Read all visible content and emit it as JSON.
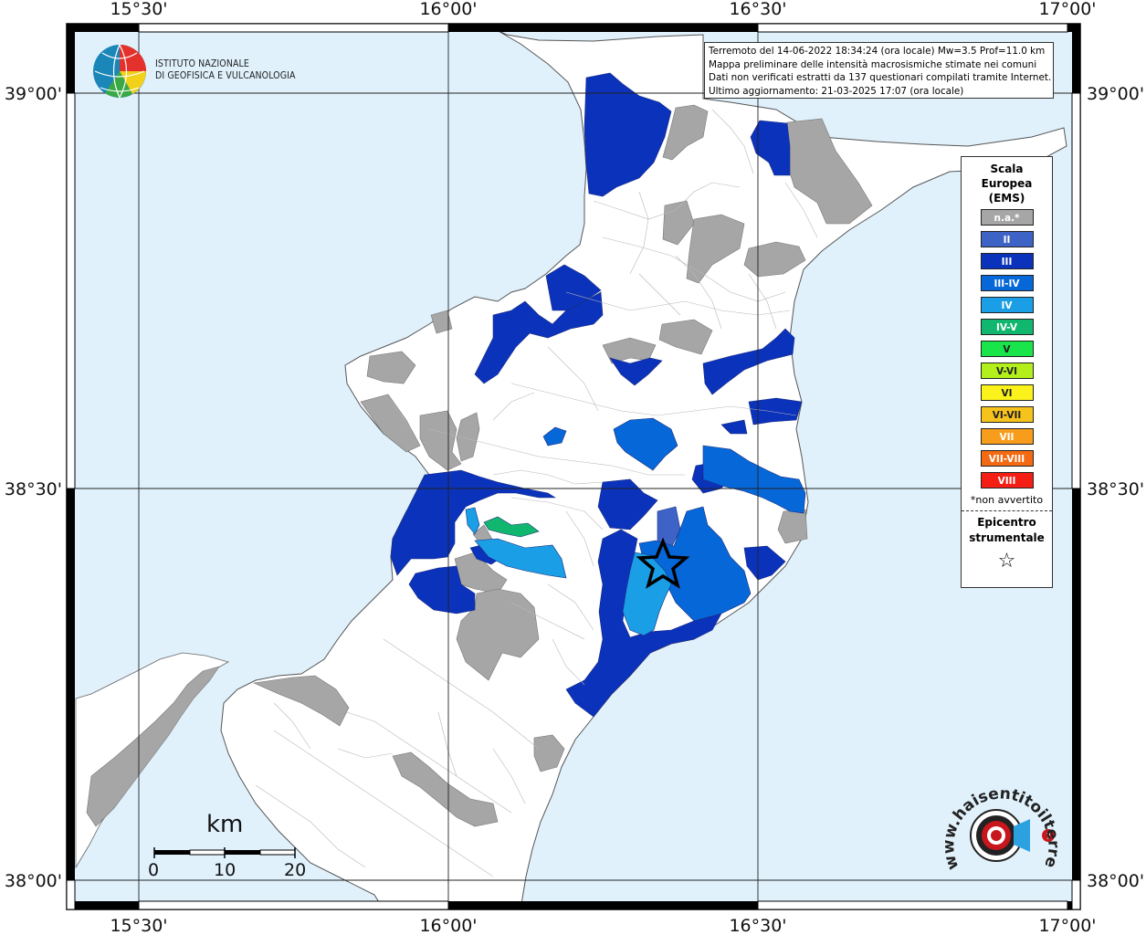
{
  "map": {
    "axes": {
      "top_longitudes": [
        "15°30'",
        "16°00'",
        "16°30'",
        "17°00'"
      ],
      "bottom_longitudes": [
        "15°30'",
        "16°00'",
        "16°30'",
        "17°00'"
      ],
      "left_latitudes": [
        "39°00'",
        "38°30'",
        "38°00'"
      ],
      "right_latitudes": [
        "39°00'",
        "38°30'",
        "38°00'"
      ]
    },
    "colors": {
      "sea": "#e0f1fc",
      "land": "#ffffff",
      "na": "#a6a6a6",
      "II": "#3e63c6",
      "III": "#0b32bb",
      "III-IV": "#0667d8",
      "IV": "#1a9ee6",
      "IV-V": "#11b76e",
      "V": "#19e44a",
      "V-VI": "#b2ef1b",
      "VI": "#fbf21b",
      "VI-VII": "#f6c21c",
      "VII": "#f89d1b",
      "VII-VIII": "#f46a12",
      "VIII": "#f51e14"
    },
    "epicenter_marker": "star-icon"
  },
  "logo": {
    "line1": "ISTITUTO NAZIONALE",
    "line2": "DI GEOFISICA E VULCANOLOGIA"
  },
  "info": {
    "line1": "Terremoto del 14-06-2022 18:34:24 (ora locale) Mw=3.5 Prof=11.0 km",
    "line2": "Mappa preliminare delle intensità macrosismiche stimate nei comuni",
    "line3": "Dati non verificati estratti da 137 questionari compilati tramite Internet.",
    "line4": "Ultimo aggiornamento: 21-03-2025 17:07 (ora locale)"
  },
  "legend": {
    "title_line1": "Scala",
    "title_line2": "Europea",
    "title_line3": "(EMS)",
    "items": [
      {
        "label": "n.a.*",
        "color": "#a6a6a6"
      },
      {
        "label": "II",
        "color": "#3e63c6"
      },
      {
        "label": "III",
        "color": "#0b32bb"
      },
      {
        "label": "III-IV",
        "color": "#0667d8"
      },
      {
        "label": "IV",
        "color": "#1a9ee6"
      },
      {
        "label": "IV-V",
        "color": "#11b76e"
      },
      {
        "label": "V",
        "color": "#19e44a"
      },
      {
        "label": "V-VI",
        "color": "#b2ef1b"
      },
      {
        "label": "VI",
        "color": "#fbf21b"
      },
      {
        "label": "VI-VII",
        "color": "#f6c21c"
      },
      {
        "label": "VII",
        "color": "#f89d1b"
      },
      {
        "label": "VII-VIII",
        "color": "#f46a12"
      },
      {
        "label": "VIII",
        "color": "#f51e14"
      }
    ],
    "note": "*non avvertito",
    "epicenter_line1": "Epicentro",
    "epicenter_line2": "strumentale",
    "epicenter_symbol": "☆"
  },
  "scale_bar": {
    "unit": "km",
    "labels": [
      "0",
      "10",
      "20"
    ]
  },
  "watermark": {
    "text": "www.haisentitoilterremoto.it",
    "icon": "speaker-target-icon"
  }
}
